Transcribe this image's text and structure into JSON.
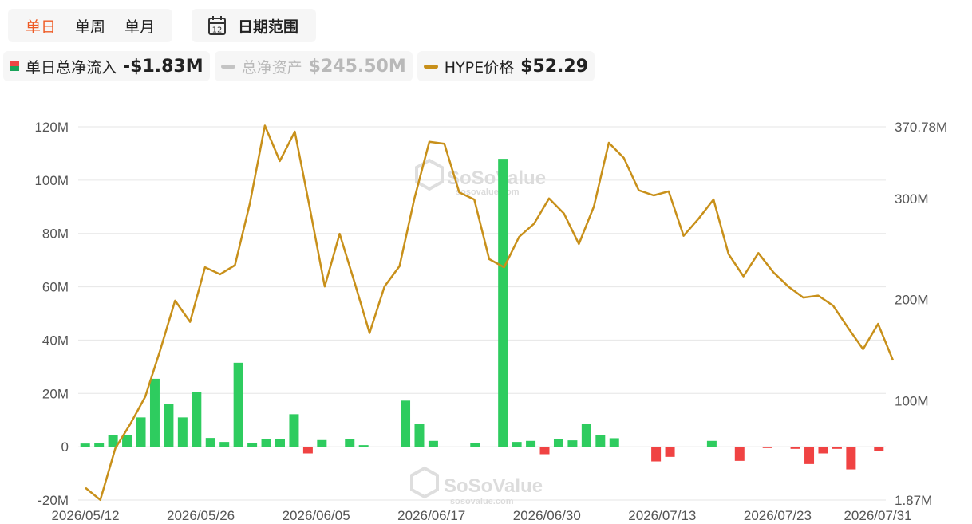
{
  "toolbar": {
    "periods": [
      {
        "label": "单日",
        "active": true
      },
      {
        "label": "单周",
        "active": false
      },
      {
        "label": "单月",
        "active": false
      }
    ],
    "calendar_icon_day": "12",
    "date_range_label": "日期范围"
  },
  "legend": {
    "flow": {
      "name": "单日总净流入",
      "value": "-$1.83M"
    },
    "assets": {
      "name": "总净资产",
      "value": "$245.50M"
    },
    "price": {
      "name": "HYPE价格",
      "value": "$52.29"
    }
  },
  "watermark": {
    "brand": "SoSoValue",
    "site": "sosovalue.com"
  },
  "colors": {
    "accent": "#ee5a24",
    "inflow": "#2ecc5f",
    "outflow": "#f04343",
    "price_line": "#c8901a",
    "assets_line": "#c4c4c4"
  },
  "chart_data": {
    "type": "bar",
    "x_tick_labels": [
      "2026/05/12",
      "2026/05/26",
      "2026/06/05",
      "2026/06/17",
      "2026/06/30",
      "2026/07/13",
      "2026/07/23",
      "2026/07/31"
    ],
    "y_left": {
      "ticks": [
        "120M",
        "100M",
        "80M",
        "60M",
        "40M",
        "20M",
        "0",
        "-20M"
      ],
      "range": [
        -20,
        120
      ],
      "unit": "M"
    },
    "y_right": {
      "ticks": [
        "370.78M",
        "300M",
        "200M",
        "100M",
        "1.87M"
      ],
      "range": [
        1.87,
        370.78
      ],
      "unit": "M"
    },
    "grid": true,
    "series": [
      {
        "name": "单日总净流入",
        "type": "bar",
        "axis": "left",
        "values": [
          1.2,
          1.3,
          4.3,
          4.5,
          11,
          25.5,
          16,
          11,
          20.5,
          3.3,
          1.8,
          31.5,
          1.3,
          3,
          3,
          12.2,
          -2.5,
          2.5,
          0,
          2.8,
          0.6,
          0,
          0,
          17.3,
          8.5,
          2.2,
          0,
          0,
          1.5,
          0,
          108,
          1.8,
          2.2,
          -2.8,
          3,
          2.4,
          8.5,
          4.3,
          3.2,
          0,
          0,
          -5.5,
          -3.8,
          0,
          0,
          2.2,
          0,
          -5.3,
          0,
          -0.5,
          0,
          -0.8,
          -6.5,
          -2.5,
          -0.8,
          -8.5,
          0,
          -1.5
        ]
      },
      {
        "name": "HYPE价格",
        "type": "line",
        "axis": "right",
        "values": [
          14,
          2,
          53,
          77,
          104,
          150,
          199,
          178,
          232,
          225,
          234,
          295,
          372,
          337,
          366,
          291,
          213,
          265,
          217,
          167,
          213,
          233,
          300,
          356,
          354,
          306,
          299,
          240,
          232,
          262,
          275,
          300,
          285,
          255,
          292,
          355,
          340,
          308,
          303,
          307,
          263,
          280,
          299,
          245,
          223,
          246,
          227,
          213,
          202,
          204,
          194,
          172,
          151,
          176,
          140
        ]
      }
    ]
  }
}
